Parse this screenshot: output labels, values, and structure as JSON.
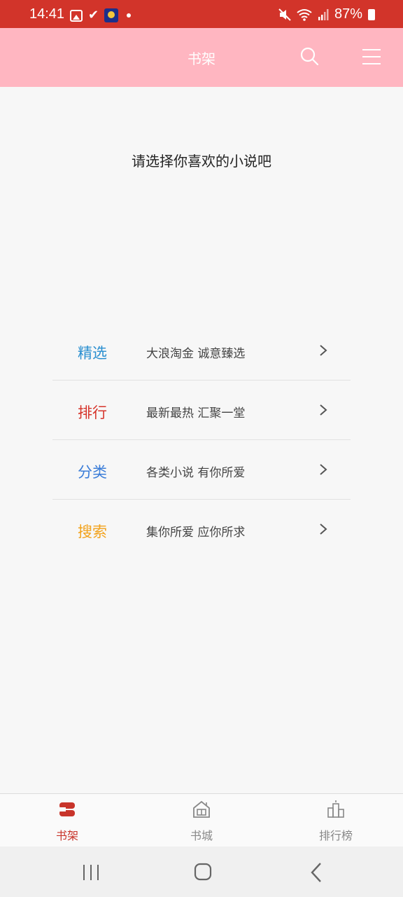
{
  "status_bar": {
    "time": "14:41",
    "battery": "87%",
    "icons": [
      "gallery-icon",
      "check-icon",
      "app-avatar-icon",
      "notification-dot",
      "mute-icon",
      "wifi-icon",
      "signal-icon",
      "battery-icon"
    ]
  },
  "header": {
    "title": "书架",
    "search_icon": "search-icon",
    "menu_icon": "menu-icon"
  },
  "main": {
    "prompt": "请选择你喜欢的小说吧"
  },
  "menu": [
    {
      "title": "精选",
      "desc": "大浪淘金  诚意臻选",
      "color": "#2a8fd0"
    },
    {
      "title": "排行",
      "desc": "最新最热  汇聚一堂",
      "color": "#d6342b"
    },
    {
      "title": "分类",
      "desc": "各类小说  有你所爱",
      "color": "#3b7dd8"
    },
    {
      "title": "搜索",
      "desc": "集你所爱  应你所求",
      "color": "#f2a21b"
    }
  ],
  "tabbar": [
    {
      "label": "书架",
      "icon": "bookshelf-icon",
      "active": true
    },
    {
      "label": "书城",
      "icon": "bookstore-icon",
      "active": false
    },
    {
      "label": "排行榜",
      "icon": "ranking-icon",
      "active": false
    }
  ],
  "navbar": {
    "recents": "recents-icon",
    "home": "home-icon",
    "back": "back-icon"
  },
  "colors": {
    "status_bar": "#d2342a",
    "header": "#ffb6c1",
    "accent": "#c8342a"
  }
}
